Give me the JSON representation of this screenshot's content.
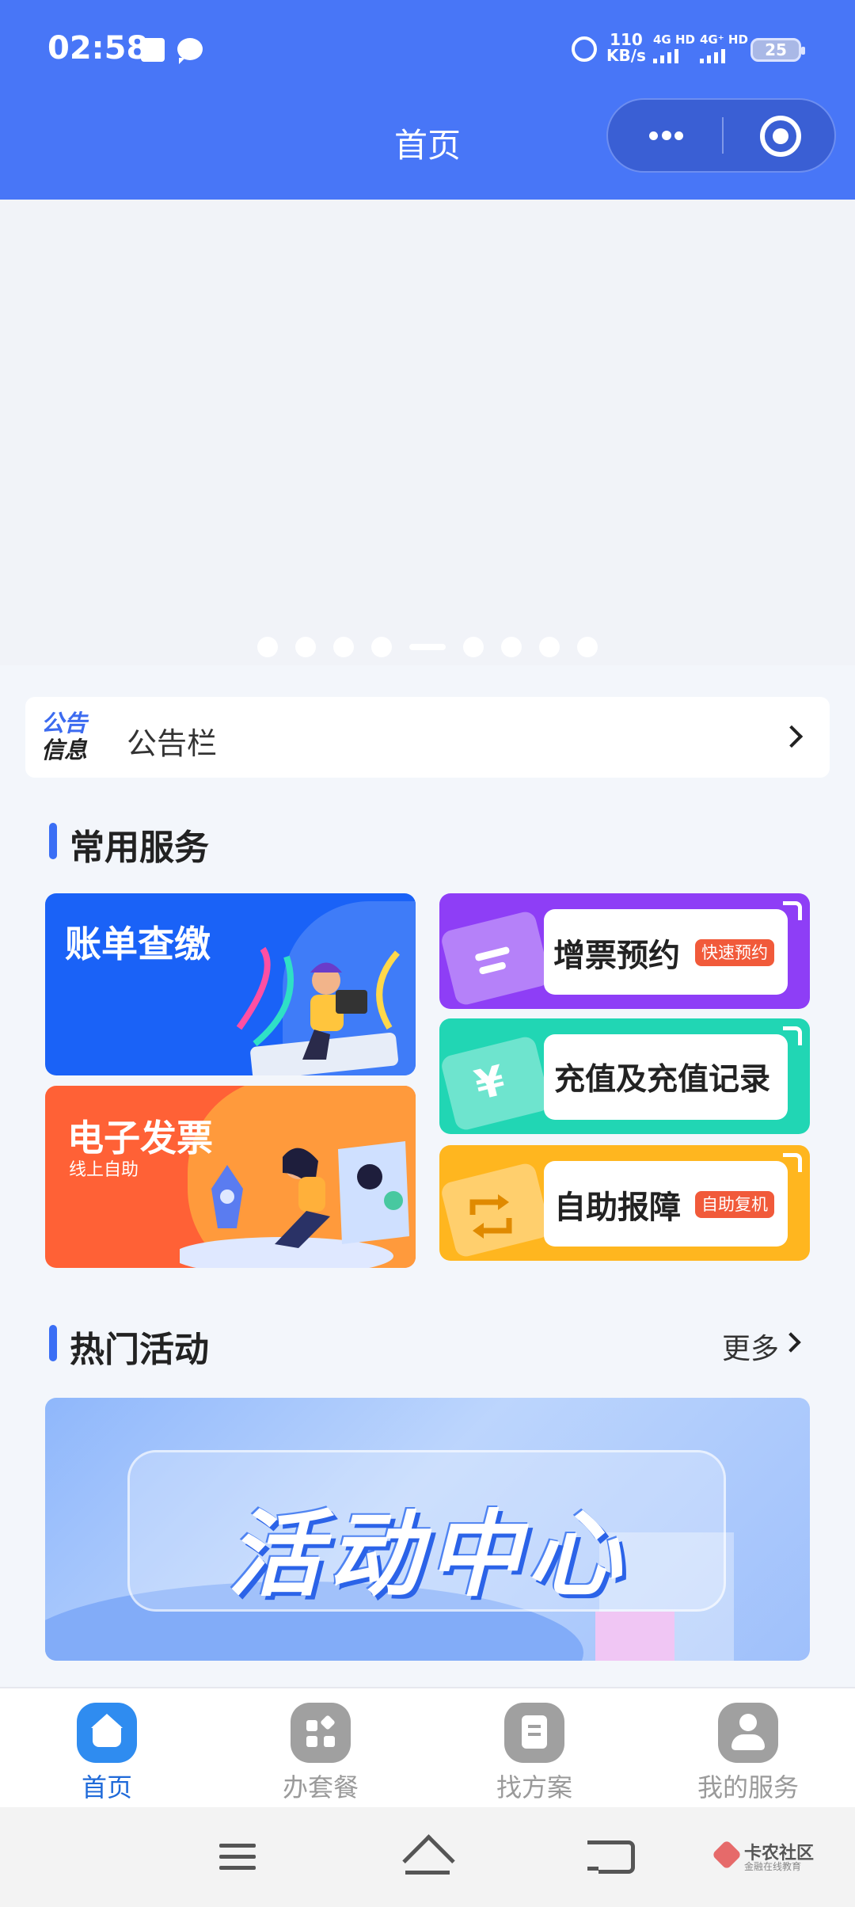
{
  "status_bar": {
    "time": "02:58",
    "net_speed": "110",
    "net_speed_unit": "KB/s",
    "sim1": "4G HD",
    "sim2": "4G⁺ HD",
    "battery": "25"
  },
  "header": {
    "title": "首页",
    "more_icon": "more-dots-icon",
    "close_icon": "target-circle-icon"
  },
  "banner": {
    "dot_count": 9,
    "active_dot_index": 4
  },
  "notice": {
    "logo_line1": "公告",
    "logo_line2": "信息",
    "text": "公告栏"
  },
  "common_services": {
    "title": "常用服务",
    "bill": {
      "title": "账单查缴"
    },
    "invoice": {
      "title": "电子发票",
      "subtitle": "线上自助"
    },
    "ticket": {
      "label": "增票预约",
      "tag": "快速预约"
    },
    "recharge": {
      "label": "充值及充值记录"
    },
    "repair": {
      "label": "自助报障",
      "tag": "自助复机"
    }
  },
  "hot_activities": {
    "title": "热门活动",
    "more": "更多",
    "banner_text": "活动中心"
  },
  "tabbar": {
    "tabs": [
      {
        "label": "首页",
        "icon": "home-icon",
        "active": true
      },
      {
        "label": "办套餐",
        "icon": "package-icon",
        "active": false
      },
      {
        "label": "找方案",
        "icon": "document-icon",
        "active": false
      },
      {
        "label": "我的服务",
        "icon": "user-icon",
        "active": false
      }
    ]
  },
  "watermark": {
    "title": "卡农社区",
    "subtitle": "金融在线教育"
  },
  "colors": {
    "header_bg": "#4876f7",
    "accent": "#3a6ef5",
    "bill_card": "#1a62f7",
    "invoice_card": "#ff6136",
    "ticket_card": "#8e3ef6",
    "recharge_card": "#21d6b4",
    "repair_card": "#ffb61f",
    "tag": "#f15a3a"
  }
}
